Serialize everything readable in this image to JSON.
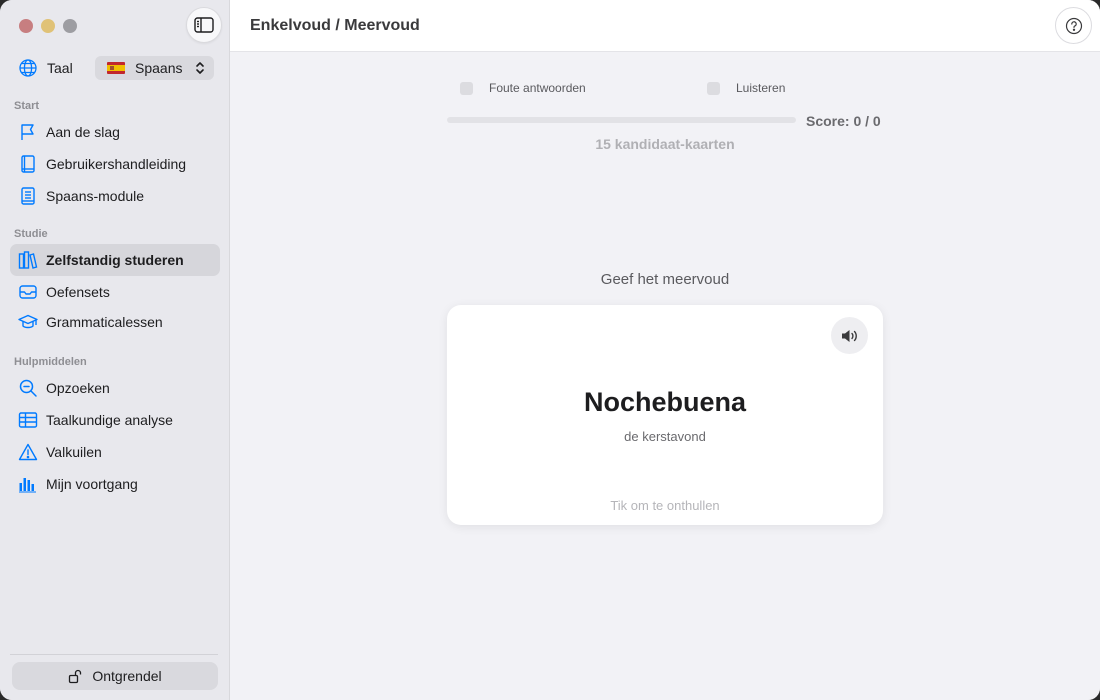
{
  "sidebar": {
    "language_label": "Taal",
    "language_value": "Spaans",
    "sections": {
      "start": "Start",
      "studie": "Studie",
      "hulpmiddelen": "Hulpmiddelen"
    },
    "items": [
      {
        "label": "Aan de slag",
        "icon": "flag-icon"
      },
      {
        "label": "Gebruikershandleiding",
        "icon": "book-icon"
      },
      {
        "label": "Spaans-module",
        "icon": "document-icon"
      },
      {
        "label": "Zelfstandig studeren",
        "icon": "books-icon",
        "active": true
      },
      {
        "label": "Oefensets",
        "icon": "tray-icon"
      },
      {
        "label": "Grammaticalessen",
        "icon": "graduation-cap-icon"
      },
      {
        "label": "Opzoeken",
        "icon": "magnifier-icon"
      },
      {
        "label": "Taalkundige analyse",
        "icon": "table-icon"
      },
      {
        "label": "Valkuilen",
        "icon": "warning-icon"
      },
      {
        "label": "Mijn voortgang",
        "icon": "bar-chart-icon"
      }
    ],
    "unlock_label": "Ontgrendel"
  },
  "header": {
    "title": "Enkelvoud / Meervoud"
  },
  "main": {
    "options": {
      "wrong_answers": "Foute antwoorden",
      "listen": "Luisteren"
    },
    "progress": 0,
    "score": "Score: 0 / 0",
    "candidates": "15 kandidaat-kaarten",
    "prompt": "Geef het meervoud",
    "card": {
      "word": "Nochebuena",
      "translation": "de kerstavond",
      "reveal_hint": "Tik om te onthullen"
    }
  },
  "colors": {
    "accent": "#007aff",
    "sidebar_bg": "#e8e8ed",
    "main_bg": "#f2f2f6"
  }
}
